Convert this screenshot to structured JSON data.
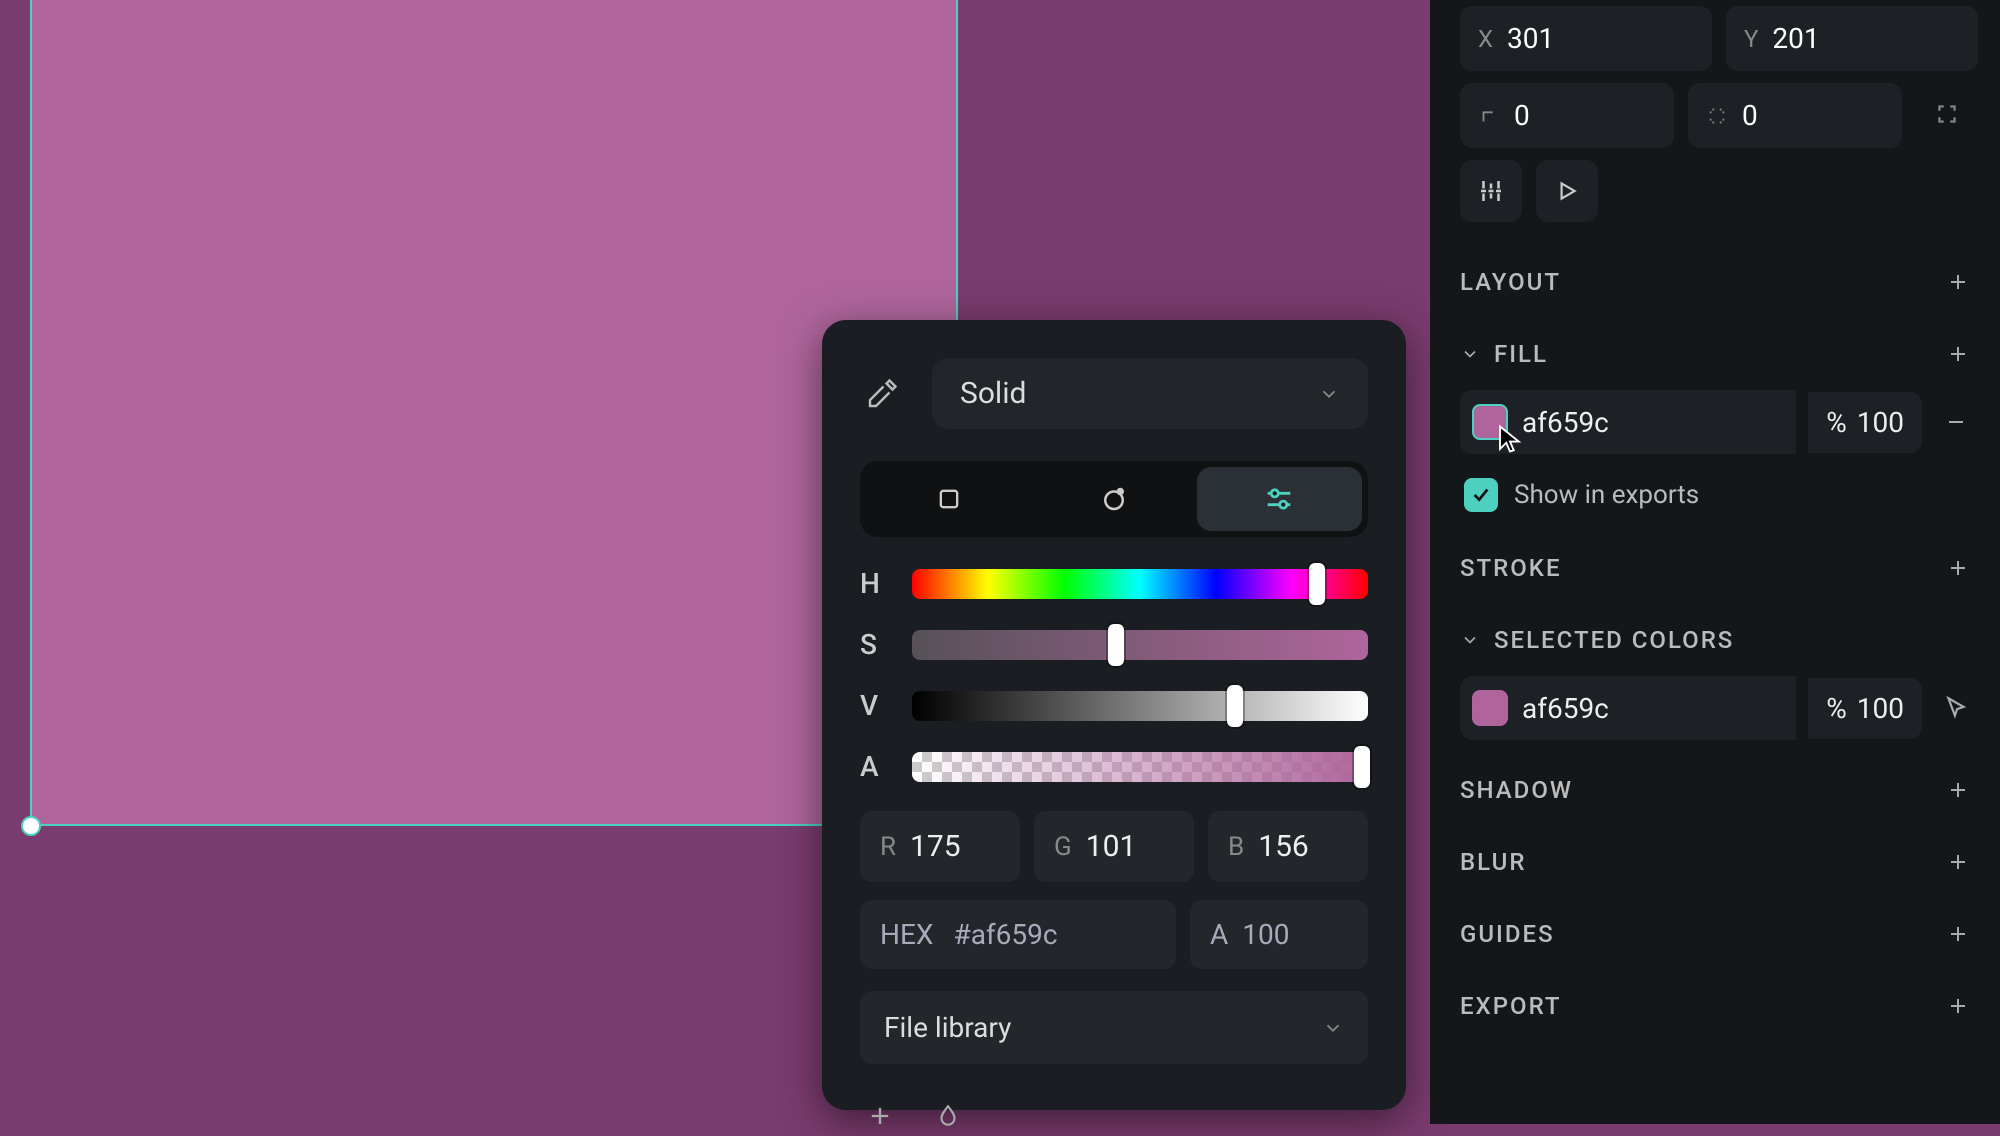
{
  "canvas": {
    "fill": "#af659c"
  },
  "colorPicker": {
    "fillType": "Solid",
    "tabs": {
      "activeIndex": 2
    },
    "sliders": {
      "H": {
        "label": "H",
        "pct": 87
      },
      "S": {
        "label": "S",
        "pct": 43
      },
      "V": {
        "label": "V",
        "pct": 69
      },
      "A": {
        "label": "A",
        "pct": 100
      }
    },
    "rgb": {
      "R": "175",
      "G": "101",
      "B": "156"
    },
    "hex": "#af659c",
    "alpha": "100",
    "libraryLabel": "File library"
  },
  "inspector": {
    "x": "301",
    "y": "201",
    "w": "0",
    "h": "0",
    "sections": {
      "layout": "LAYOUT",
      "fill": "FILL",
      "stroke": "STROKE",
      "selected": "SELECTED COLORS",
      "shadow": "SHADOW",
      "blur": "BLUR",
      "guides": "GUIDES",
      "export": "EXPORT"
    },
    "fillItem": {
      "hex": "af659c",
      "opacity": "100",
      "pctPrefix": "%"
    },
    "showInExports": "Show in exports",
    "selectedItem": {
      "hex": "af659c",
      "opacity": "100",
      "pctPrefix": "%"
    },
    "labels": {
      "x": "X",
      "y": "Y",
      "r": "R",
      "g": "G",
      "b": "B",
      "hex": "HEX",
      "a": "A"
    }
  }
}
